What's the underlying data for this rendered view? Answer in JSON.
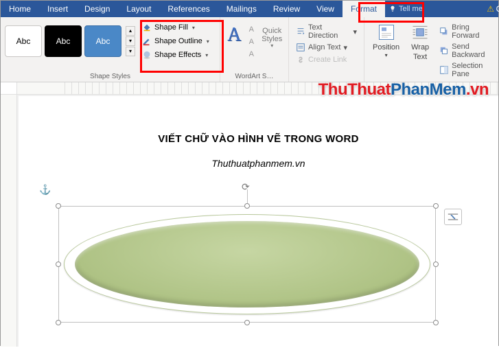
{
  "tabs": {
    "home": "Home",
    "insert": "Insert",
    "design": "Design",
    "layout": "Layout",
    "references": "References",
    "mailings": "Mailings",
    "review": "Review",
    "view": "View",
    "format": "Format",
    "tellme": "Tell me",
    "alert_suffix": "Ch"
  },
  "ribbon": {
    "shape_styles": {
      "label": "Shape Styles",
      "thumb_text": "Abc",
      "fill": "Shape Fill",
      "outline": "Shape Outline",
      "effects": "Shape Effects"
    },
    "wordart": {
      "label": "WordArt S…",
      "quick_styles1": "Quick",
      "quick_styles2": "Styles"
    },
    "text": {
      "direction": "Text Direction",
      "align": "Align Text",
      "link": "Create Link"
    },
    "arrange": {
      "position": "Position",
      "wrap1": "Wrap",
      "wrap2": "Text",
      "bring": "Bring Forward",
      "send": "Send Backward",
      "pane": "Selection Pane"
    }
  },
  "document": {
    "title": "VIẾT CHỮ VÀO HÌNH VẼ TRONG WORD",
    "subtitle": "Thuthuatphanmem.vn"
  },
  "watermark": {
    "p1": "ThuThuat",
    "p2": "PhanMem",
    "p3": ".vn"
  }
}
